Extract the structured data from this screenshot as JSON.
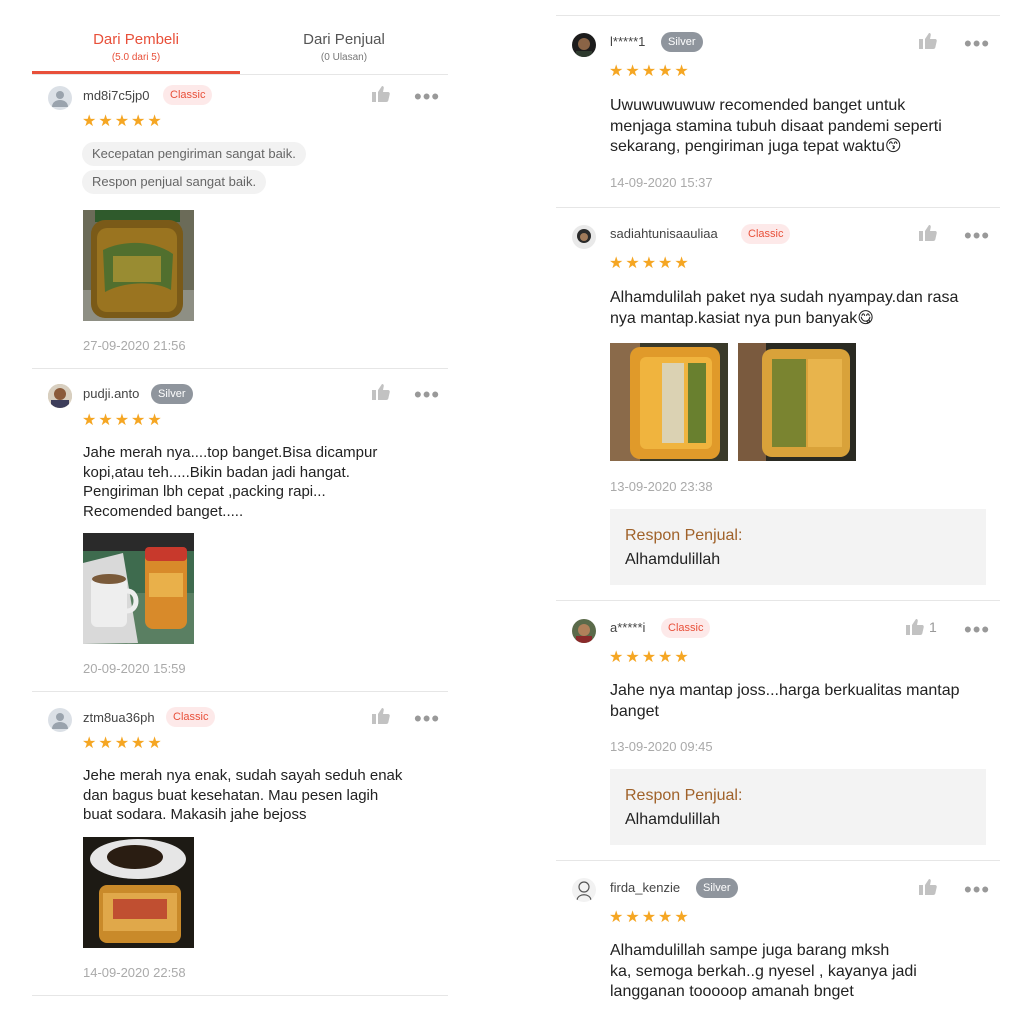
{
  "tabs": {
    "buyer": {
      "label": "Dari Pembeli",
      "sub": "(5.0 dari 5)"
    },
    "seller": {
      "label": "Dari Penjual",
      "sub": "(0 Ulasan)"
    }
  },
  "colors": {
    "accent": "#e8503a",
    "star": "#f5a623",
    "response_label": "#a0622a"
  },
  "icons": {
    "like": "thumbs-up-icon",
    "more": "more-dots-icon",
    "star": "star-icon",
    "avatar": "user-avatar-icon"
  },
  "stars_text": "★★★★★",
  "more_text": "•••",
  "left_reviews": [
    {
      "user": "md8i7c5jp0",
      "badge": "Classic",
      "rating": 5,
      "chips": [
        "Kecepatan pengiriman sangat baik.",
        "Respon penjual sangat baik."
      ],
      "date": "27-09-2020 21:56"
    },
    {
      "user": "pudji.anto",
      "badge": "Silver",
      "rating": 5,
      "text": [
        "Jahe merah nya....top banget.Bisa dicampur",
        "kopi,atau teh.....Bikin badan jadi hangat.",
        "Pengiriman lbh cepat ,packing rapi...",
        "Recomended banget....."
      ],
      "date": "20-09-2020 15:59"
    },
    {
      "user": "ztm8ua36ph",
      "badge": "Classic",
      "rating": 5,
      "text": [
        "Jehe merah nya enak, sudah sayah seduh enak",
        "dan bagus buat kesehatan.  Mau pesen lagih",
        "buat sodara.  Makasih jahe bejoss"
      ],
      "date": "14-09-2020 22:58"
    }
  ],
  "right_reviews": [
    {
      "user": "l*****1",
      "badge": "Silver",
      "rating": 5,
      "text": [
        "Uwuwuwuwuw recomended banget untuk",
        "menjaga stamina tubuh disaat pandemi seperti",
        "sekarang, pengiriman juga tepat waktu😙"
      ],
      "date": "14-09-2020 15:37"
    },
    {
      "user": "sadiahtunisaauliaa",
      "badge": "Classic",
      "rating": 5,
      "text": [
        "Alhamdulilah paket nya sudah nyampay.dan rasa",
        "nya mantap.kasiat nya pun banyak😋"
      ],
      "date": "13-09-2020 23:38",
      "response_label": "Respon Penjual:",
      "response": "Alhamdulillah"
    },
    {
      "user": "a*****i",
      "badge": "Classic",
      "rating": 5,
      "likes": "1",
      "text": [
        "Jahe nya mantap joss...harga berkualitas mantap",
        "banget"
      ],
      "date": "13-09-2020 09:45",
      "response_label": "Respon Penjual:",
      "response": "Alhamdulillah"
    },
    {
      "user": "firda_kenzie",
      "badge": "Silver",
      "rating": 5,
      "text": [
        "Alhamdulillah sampe juga barang mksh",
        "ka, semoga berkah..g nyesel  , kayanya jadi",
        "langganan tooooop amanah bnget"
      ]
    }
  ]
}
